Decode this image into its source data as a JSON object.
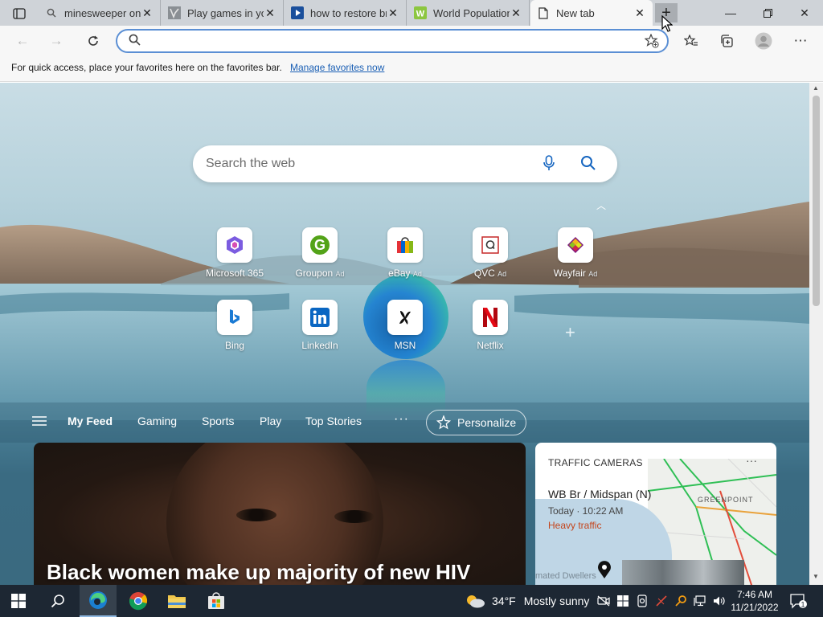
{
  "tabs": [
    {
      "title": "minesweeper online",
      "icon": "search-icon"
    },
    {
      "title": "Play games in your browser",
      "icon": "games-favicon"
    },
    {
      "title": "how to restore browser",
      "icon": "video-favicon"
    },
    {
      "title": "World Population",
      "icon": "worldometer-favicon"
    },
    {
      "title": "New tab",
      "icon": "page-icon"
    }
  ],
  "toolbar": {
    "address_value": "",
    "address_placeholder": ""
  },
  "favorites_bar": {
    "text": "For quick access, place your favorites here on the favorites bar.",
    "link": "Manage favorites now"
  },
  "search": {
    "placeholder": "Search the web"
  },
  "quick_links": [
    {
      "label": "Microsoft 365",
      "ad": ""
    },
    {
      "label": "Groupon",
      "ad": "Ad"
    },
    {
      "label": "eBay",
      "ad": "Ad"
    },
    {
      "label": "QVC",
      "ad": "Ad"
    },
    {
      "label": "Wayfair",
      "ad": "Ad"
    },
    {
      "label": "Bing",
      "ad": ""
    },
    {
      "label": "LinkedIn",
      "ad": ""
    },
    {
      "label": "MSN",
      "ad": ""
    },
    {
      "label": "Netflix",
      "ad": ""
    }
  ],
  "feed_nav": {
    "tabs": [
      "My Feed",
      "Gaming",
      "Sports",
      "Play",
      "Top Stories"
    ],
    "more": "···",
    "personalize": "Personalize"
  },
  "news_card": {
    "headline": "Black women make up majority of new HIV"
  },
  "traffic_card": {
    "header": "TRAFFIC CAMERAS",
    "location": "WB Br / Midspan (N)",
    "time": "Today · 10:22 AM",
    "status": "Heavy traffic",
    "area": "GREENPOINT",
    "map_text": "mated Dwellers"
  },
  "taskbar": {
    "weather_temp": "34°F",
    "weather_desc": "Mostly sunny",
    "time": "7:46 AM",
    "date": "11/21/2022",
    "notifications": "1"
  },
  "colors": {
    "accent": "#5b8fd4",
    "link": "#1a5fb4",
    "traffic_status": "#c4451c",
    "taskbar": "#1d2733"
  }
}
